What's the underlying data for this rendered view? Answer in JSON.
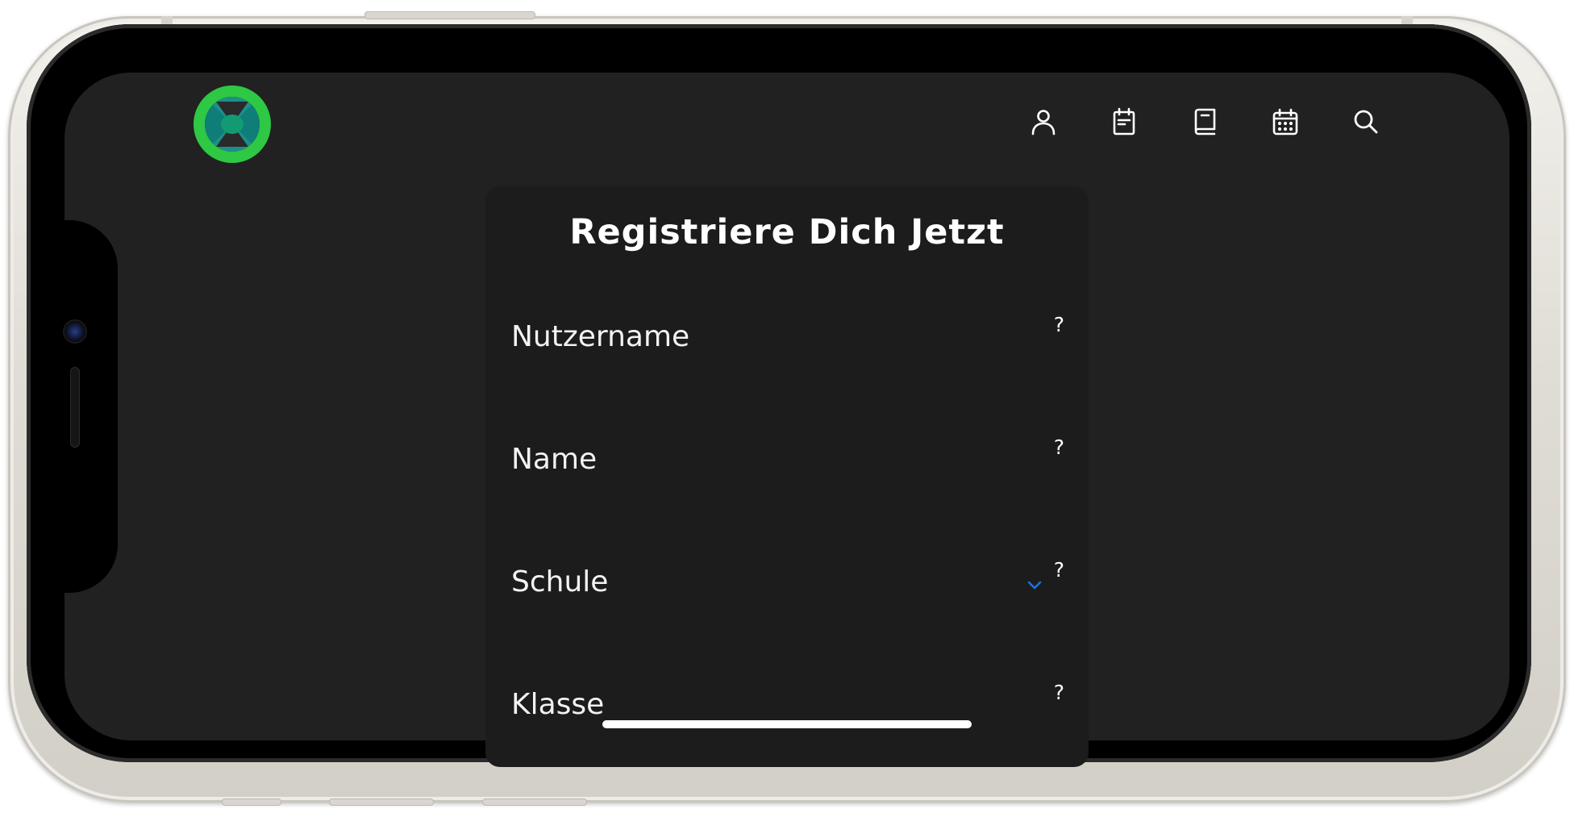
{
  "app": {
    "logo_icon": "brand-logo-icon",
    "accent_color": "#2ec845",
    "background_color": "#212121",
    "card_color": "#1c1c1c"
  },
  "header": {
    "nav": [
      {
        "icon": "profile-icon"
      },
      {
        "icon": "notes-icon"
      },
      {
        "icon": "book-icon"
      },
      {
        "icon": "calendar-icon"
      },
      {
        "icon": "search-icon"
      }
    ]
  },
  "registration": {
    "title": "Registriere Dich Jetzt",
    "fields": {
      "username": {
        "label": "Nutzername",
        "help": "?"
      },
      "name": {
        "label": "Name",
        "help": "?"
      },
      "school": {
        "label": "Schule",
        "help": "?",
        "dropdown_icon": "chevron-down-icon",
        "dropdown_color": "#1f6fe0"
      },
      "class": {
        "label": "Klasse",
        "help": "?"
      }
    }
  }
}
